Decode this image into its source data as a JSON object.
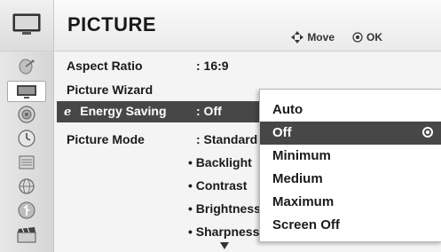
{
  "header": {
    "title": "PICTURE",
    "move_hint": "Move",
    "ok_hint": "OK",
    "move_icon": "four-way-arrow-icon",
    "ok_icon": "ok-button-icon"
  },
  "sidebar": {
    "icons": [
      "satellite-dish-icon",
      "tv-screen-icon",
      "speaker-icon",
      "clock-icon",
      "lock-icon",
      "globe-icon",
      "usb-icon",
      "clapperboard-icon"
    ],
    "active": "tv-screen-icon"
  },
  "menu": {
    "aspect_ratio": {
      "label": "Aspect Ratio",
      "value": ": 16:9"
    },
    "picture_wizard": {
      "label": "Picture Wizard"
    },
    "energy_saving": {
      "icon_text": "e",
      "label": "Energy Saving",
      "value": ": Off"
    },
    "picture_mode": {
      "label": "Picture Mode",
      "value": ": Standard"
    },
    "sub_items": [
      "• Backlight",
      "• Contrast",
      "• Brightness",
      "• Sharpness"
    ]
  },
  "popup": {
    "options": [
      "Auto",
      "Off",
      "Minimum",
      "Medium",
      "Maximum",
      "Screen Off"
    ],
    "selected": "Off"
  },
  "colors": {
    "selection_bg": "#474747",
    "panel_bg": "#f4f4f4"
  }
}
